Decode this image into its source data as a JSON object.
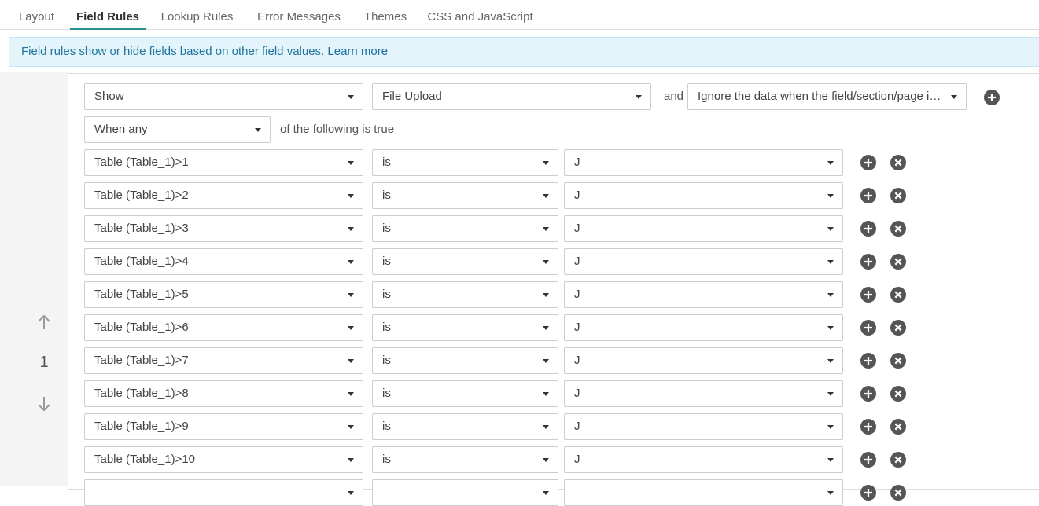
{
  "tabs": [
    {
      "label": "Layout"
    },
    {
      "label": "Field Rules"
    },
    {
      "label": "Lookup Rules"
    },
    {
      "label": "Error Messages"
    },
    {
      "label": "Themes"
    },
    {
      "label": "CSS and JavaScript"
    }
  ],
  "active_tab": "Field Rules",
  "banner": {
    "text": "Field rules show or hide fields based on other field values.",
    "link": "Learn more"
  },
  "rule": {
    "number": "1",
    "action": "Show",
    "target_field": "File Upload",
    "and_label": "and",
    "data_option": "Ignore the data when the field/section/page is ...",
    "match_mode": "When any",
    "match_suffix": "of the following is true",
    "conditions": [
      {
        "field": "Table (Table_1)>1",
        "operator": "is",
        "value": "J"
      },
      {
        "field": "Table (Table_1)>2",
        "operator": "is",
        "value": "J"
      },
      {
        "field": "Table (Table_1)>3",
        "operator": "is",
        "value": "J"
      },
      {
        "field": "Table (Table_1)>4",
        "operator": "is",
        "value": "J"
      },
      {
        "field": "Table (Table_1)>5",
        "operator": "is",
        "value": "J"
      },
      {
        "field": "Table (Table_1)>6",
        "operator": "is",
        "value": "J"
      },
      {
        "field": "Table (Table_1)>7",
        "operator": "is",
        "value": "J"
      },
      {
        "field": "Table (Table_1)>8",
        "operator": "is",
        "value": "J"
      },
      {
        "field": "Table (Table_1)>9",
        "operator": "is",
        "value": "J"
      },
      {
        "field": "Table (Table_1)>10",
        "operator": "is",
        "value": "J"
      },
      {
        "field": "",
        "operator": "",
        "value": ""
      }
    ]
  },
  "icons": {
    "move_up": "arrow-up-icon",
    "move_down": "arrow-down-icon",
    "add": "plus-circle-icon",
    "remove": "x-circle-icon",
    "dropdown": "caret-down-icon"
  },
  "colors": {
    "accent": "#2a8f8f",
    "banner_bg": "#e3f4fb",
    "banner_text": "#21749f",
    "icon_button": "#555555"
  }
}
